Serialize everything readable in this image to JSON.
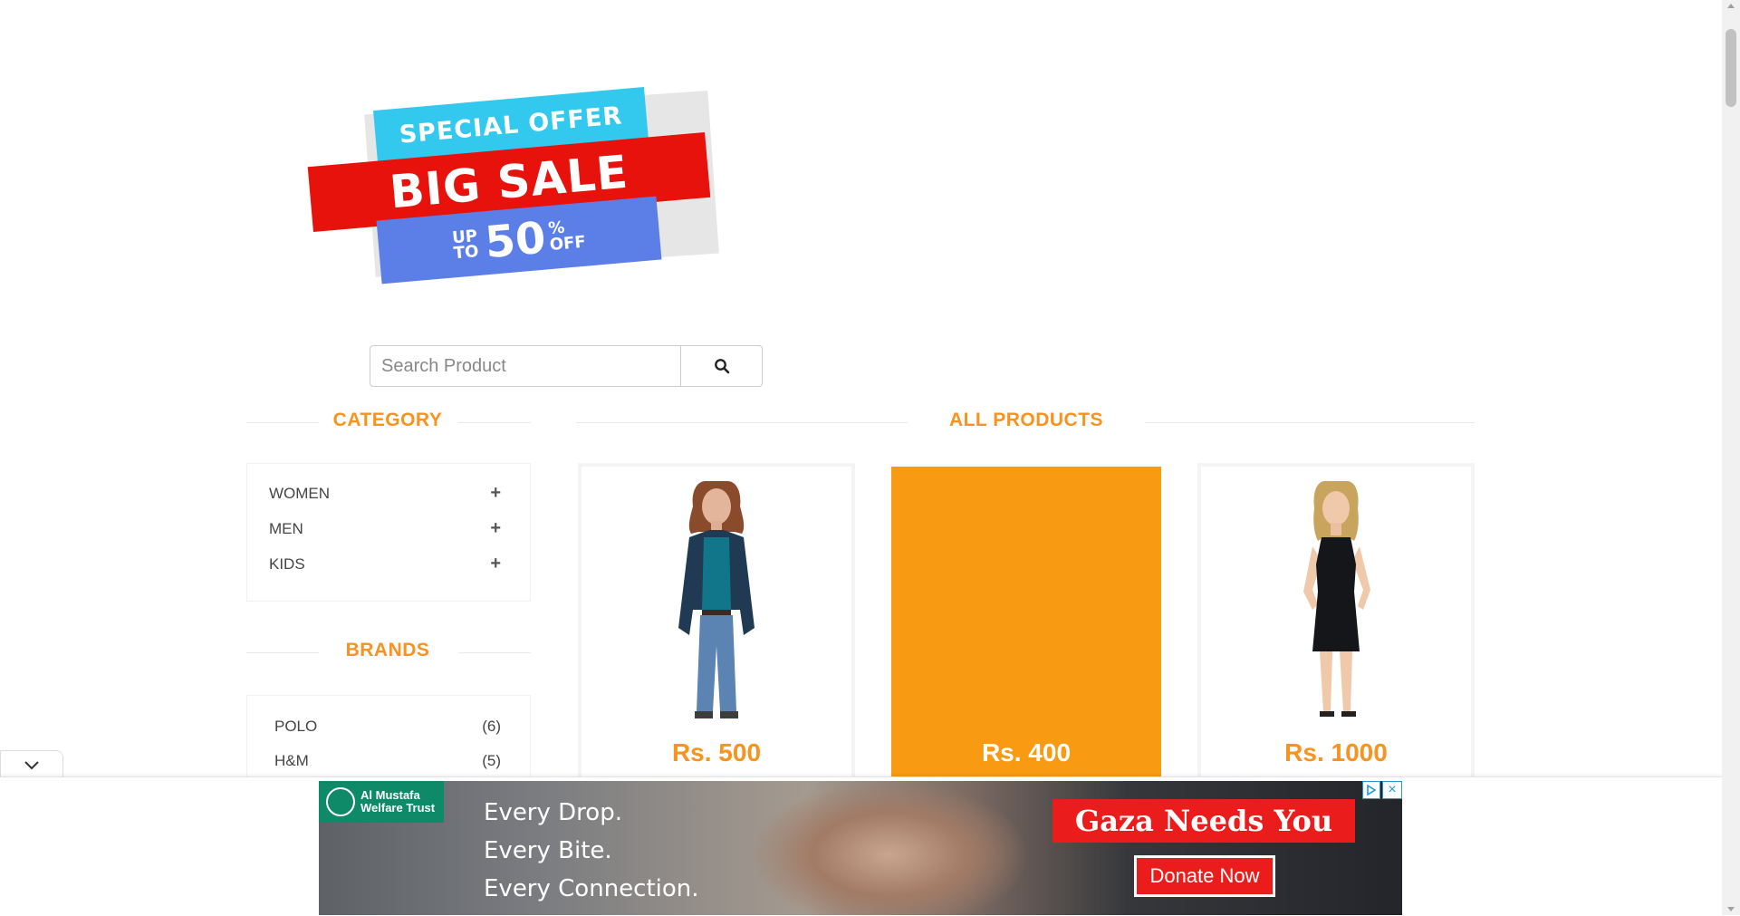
{
  "banner": {
    "line1": "SPECIAL OFFER",
    "line2": "BIG SALE",
    "upto_1": "UP",
    "upto_2": "TO",
    "percent": "50",
    "percent_sign": "%",
    "off": "OFF"
  },
  "search": {
    "placeholder": "Search Product",
    "button_icon": "search-icon"
  },
  "sidebar": {
    "category_title": "CATEGORY",
    "categories": [
      {
        "label": "WOMEN",
        "icon": "plus-icon"
      },
      {
        "label": "MEN",
        "icon": "plus-icon"
      },
      {
        "label": "KIDS",
        "icon": "plus-icon"
      }
    ],
    "brands_title": "BRANDS",
    "brands": [
      {
        "label": "POLO",
        "count": "(6)"
      },
      {
        "label": "H&M",
        "count": "(5)"
      }
    ]
  },
  "main": {
    "title": "ALL PRODUCTS",
    "products": [
      {
        "price": "Rs. 500",
        "image": "woman-cardigan-photo"
      },
      {
        "price": "Rs. 400",
        "image": "hover-overlay"
      },
      {
        "price": "Rs. 1000",
        "image": "woman-black-dress-photo"
      }
    ]
  },
  "ad": {
    "org": "Al Mustafa Welfare Trust",
    "line1": "Every Drop.",
    "line2": "Every Bite.",
    "line3": "Every Connection.",
    "headline": "Gaza Needs You",
    "cta": "Donate Now"
  },
  "colors": {
    "accent": "#f7931e",
    "active_card": "#f99a13",
    "banner_red": "#e8120c",
    "banner_cyan": "#33c8ee",
    "banner_blue": "#5b7fe6",
    "ad_red": "#ea1c1c"
  }
}
